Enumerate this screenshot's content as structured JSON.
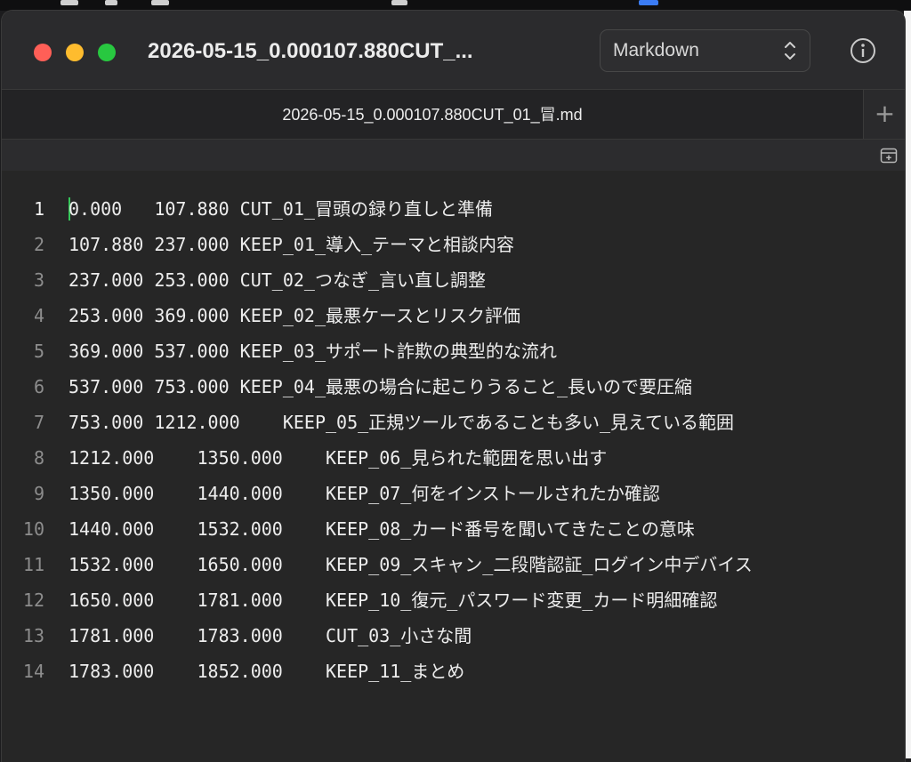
{
  "window": {
    "title": "2026-05-15_0.000107.880CUT_...",
    "language": "Markdown"
  },
  "tab": {
    "label": "2026-05-15_0.000107.880CUT_01_冒.md"
  },
  "icons": {
    "info": "info-circle-icon",
    "add_tab": "plus-icon",
    "outline": "outline-toggle-icon",
    "select_chevron": "up-down-chevron-icon"
  },
  "colors": {
    "caret": "#35c759",
    "close": "#ff5f57",
    "minimize": "#febc2e",
    "zoom": "#28c840"
  },
  "editor": {
    "active_line": 1,
    "lines": [
      {
        "n": "1",
        "text": "0.000   107.880 CUT_01_冒頭の録り直しと準備"
      },
      {
        "n": "2",
        "text": "107.880 237.000 KEEP_01_導入_テーマと相談内容"
      },
      {
        "n": "3",
        "text": "237.000 253.000 CUT_02_つなぎ_言い直し調整"
      },
      {
        "n": "4",
        "text": "253.000 369.000 KEEP_02_最悪ケースとリスク評価"
      },
      {
        "n": "5",
        "text": "369.000 537.000 KEEP_03_サポート詐欺の典型的な流れ"
      },
      {
        "n": "6",
        "text": "537.000 753.000 KEEP_04_最悪の場合に起こりうること_長いので要圧縮"
      },
      {
        "n": "7",
        "text": "753.000 1212.000    KEEP_05_正規ツールであることも多い_見えている範囲"
      },
      {
        "n": "8",
        "text": "1212.000    1350.000    KEEP_06_見られた範囲を思い出す"
      },
      {
        "n": "9",
        "text": "1350.000    1440.000    KEEP_07_何をインストールされたか確認"
      },
      {
        "n": "10",
        "text": "1440.000    1532.000    KEEP_08_カード番号を聞いてきたことの意味"
      },
      {
        "n": "11",
        "text": "1532.000    1650.000    KEEP_09_スキャン_二段階認証_ログイン中デバイス"
      },
      {
        "n": "12",
        "text": "1650.000    1781.000    KEEP_10_復元_パスワード変更_カード明細確認"
      },
      {
        "n": "13",
        "text": "1781.000    1783.000    CUT_03_小さな間"
      },
      {
        "n": "14",
        "text": "1783.000    1852.000    KEEP_11_まとめ"
      }
    ]
  }
}
